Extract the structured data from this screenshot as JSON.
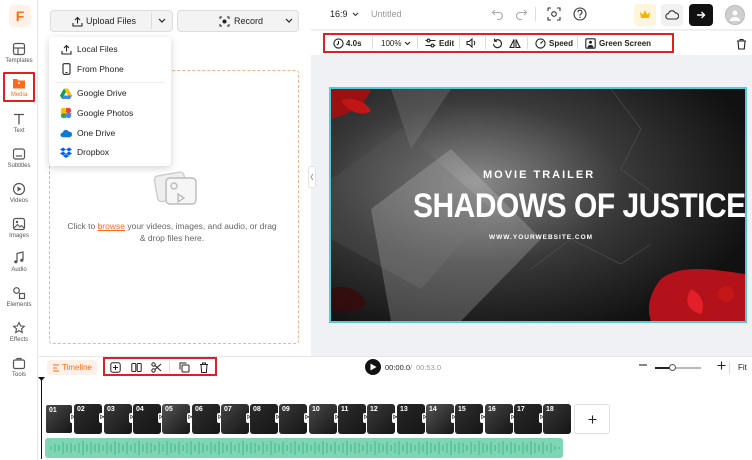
{
  "app": {
    "logo": "F"
  },
  "sidebar": {
    "items": [
      {
        "label": "Templates",
        "icon": "templates-icon"
      },
      {
        "label": "Media",
        "icon": "media-icon"
      },
      {
        "label": "Text",
        "icon": "text-icon"
      },
      {
        "label": "Subtitles",
        "icon": "subtitles-icon"
      },
      {
        "label": "Videos",
        "icon": "videos-icon"
      },
      {
        "label": "Images",
        "icon": "images-icon"
      },
      {
        "label": "Audio",
        "icon": "audio-icon"
      },
      {
        "label": "Elements",
        "icon": "elements-icon"
      },
      {
        "label": "Effects",
        "icon": "effects-icon"
      },
      {
        "label": "Tools",
        "icon": "tools-icon"
      }
    ]
  },
  "panel": {
    "upload_label": "Upload Files",
    "record_label": "Record",
    "dropzone_prefix": "Click to ",
    "dropzone_link": "browse",
    "dropzone_suffix": " your videos, images, and audio, or drag & drop files here.",
    "menu": [
      {
        "label": "Local Files",
        "icon": "upload-icon"
      },
      {
        "label": "From Phone",
        "icon": "phone-icon"
      },
      {
        "label": "Google Drive",
        "icon": "google-drive-icon"
      },
      {
        "label": "Google Photos",
        "icon": "google-photos-icon"
      },
      {
        "label": "One Drive",
        "icon": "onedrive-icon"
      },
      {
        "label": "Dropbox",
        "icon": "dropbox-icon"
      }
    ]
  },
  "header": {
    "ratio": "16:9",
    "title": "Untitled"
  },
  "toolbar": {
    "duration": "4.0s",
    "zoom": "100%",
    "edit": "Edit",
    "speed": "Speed",
    "green_screen": "Green Screen"
  },
  "preview": {
    "kicker": "MOVIE TRAILER",
    "title": "SHADOWS OF JUSTICE",
    "url": "WWW.YOURWEBSITE.COM"
  },
  "timeline": {
    "label": "Timeline",
    "current_time": "00:00.0",
    "separator": "/",
    "total_time": "00:53.0",
    "fit": "Fit",
    "clips": [
      "01",
      "02",
      "03",
      "04",
      "05",
      "06",
      "07",
      "08",
      "09",
      "10",
      "11",
      "12",
      "13",
      "14",
      "15",
      "16",
      "17",
      "18"
    ]
  },
  "colors": {
    "accent": "#ff6a1a",
    "highlight_box": "#e02020",
    "preview_border": "#56c8d6",
    "audio_track": "#7fd6b5"
  }
}
